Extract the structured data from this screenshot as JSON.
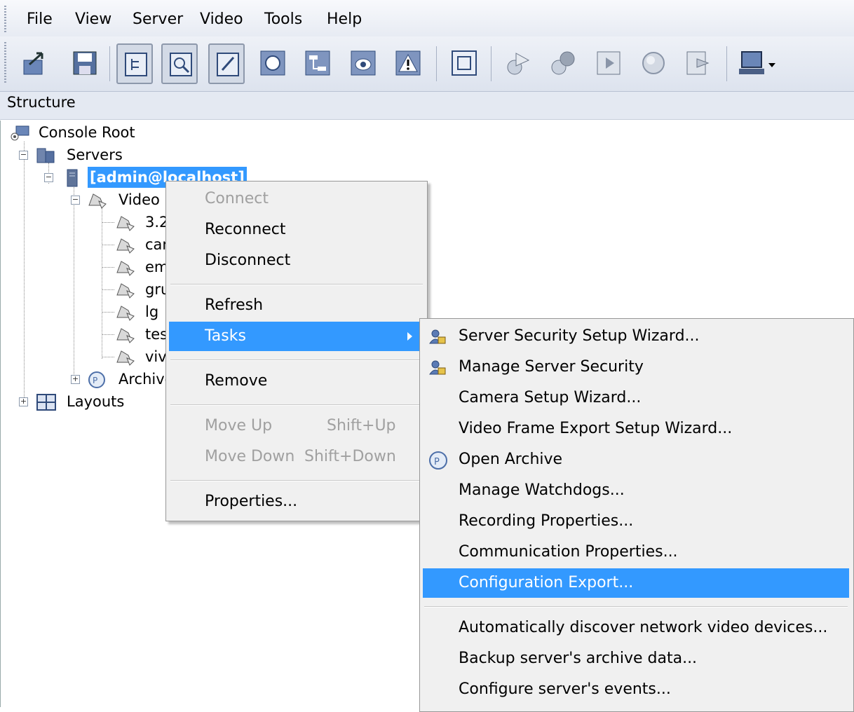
{
  "menubar": {
    "items": [
      "File",
      "View",
      "Server",
      "Video",
      "Tools",
      "Help"
    ]
  },
  "toolbar": {
    "buttons": [
      "export-icon",
      "save-icon",
      "tree-view-icon",
      "search-view-icon",
      "edit-view-icon",
      "circle-icon",
      "network-icon",
      "camera-icon",
      "warning-icon",
      "fit-icon",
      "play-icon",
      "group-icon",
      "film-icon",
      "globe-icon",
      "forward-icon",
      "monitor-icon"
    ]
  },
  "structure": {
    "title": "Structure"
  },
  "tree": {
    "root": "Console Root",
    "servers": "Servers",
    "server": "[admin@localhost]",
    "video": "Video",
    "cameras": [
      "3.2",
      "car",
      "em",
      "gru",
      "lg",
      "tes",
      "viv"
    ],
    "archive": "Archive",
    "layouts": "Layouts"
  },
  "context_menu": {
    "connect": "Connect",
    "reconnect": "Reconnect",
    "disconnect": "Disconnect",
    "refresh": "Refresh",
    "tasks": "Tasks",
    "remove": "Remove",
    "move_up": "Move Up",
    "move_up_shortcut": "Shift+Up",
    "move_down": "Move Down",
    "move_down_shortcut": "Shift+Down",
    "properties": "Properties..."
  },
  "tasks_menu": {
    "items": [
      "Server Security Setup Wizard...",
      "Manage Server Security",
      "Camera Setup Wizard...",
      "Video Frame Export Setup Wizard...",
      "Open Archive",
      "Manage Watchdogs...",
      "Recording Properties...",
      "Communication Properties...",
      "Configuration Export...",
      "Automatically discover network video devices...",
      "Backup server's archive data...",
      "Configure server's events..."
    ]
  },
  "colors": {
    "highlight": "#3399ff",
    "menu_bg": "#f0f0f0",
    "disabled_text": "#a0a0a0"
  }
}
